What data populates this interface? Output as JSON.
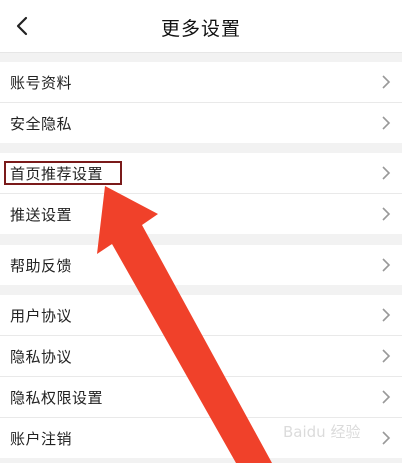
{
  "header": {
    "title": "更多设置",
    "back_icon": "chevron-left-icon"
  },
  "groups": [
    {
      "items": [
        {
          "label": "账号资料"
        },
        {
          "label": "安全隐私"
        }
      ]
    },
    {
      "items": [
        {
          "label": "首页推荐设置",
          "highlighted": true
        },
        {
          "label": "推送设置"
        }
      ]
    },
    {
      "items": [
        {
          "label": "帮助反馈"
        }
      ]
    },
    {
      "items": [
        {
          "label": "用户协议"
        },
        {
          "label": "隐私协议"
        },
        {
          "label": "隐私权限设置"
        },
        {
          "label": "账户注销"
        }
      ]
    }
  ],
  "annotation": {
    "arrow_color": "#f0412a",
    "highlight_color": "#7a1a1a"
  },
  "watermark": {
    "text": "Baidu 经验"
  }
}
